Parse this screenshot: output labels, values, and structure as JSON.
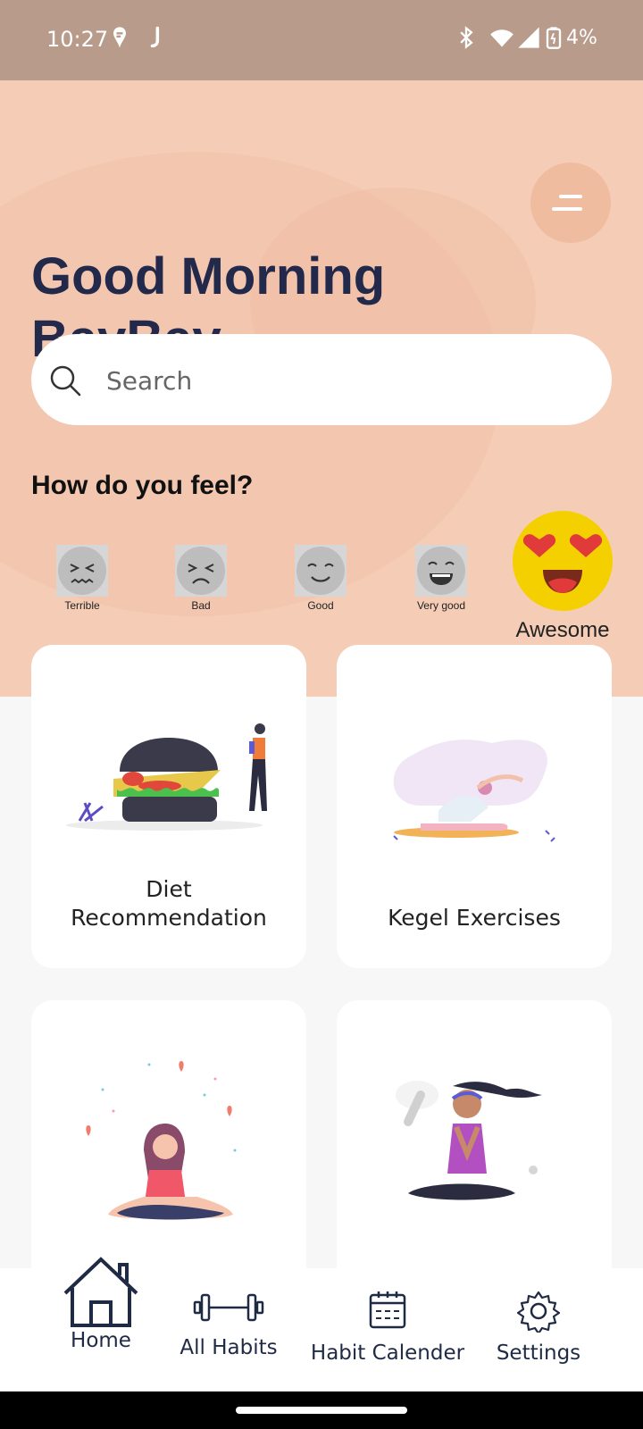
{
  "status_bar": {
    "time": "10:27",
    "battery": "4%"
  },
  "header": {
    "greeting": "Good Morning",
    "username": "BavBav",
    "menu_icon": "menu-icon"
  },
  "search": {
    "placeholder": "Search"
  },
  "mood": {
    "title": "How do you feel?",
    "options": [
      {
        "label": "Terrible"
      },
      {
        "label": "Bad"
      },
      {
        "label": "Good"
      },
      {
        "label": "Very good"
      },
      {
        "label": "Awesome"
      }
    ],
    "selected": "Awesome"
  },
  "cards": [
    {
      "line1": "Diet",
      "line2": "Recommendation"
    },
    {
      "line1": "",
      "line2": "Kegel Exercises"
    },
    {
      "line1": "",
      "line2": ""
    },
    {
      "line1": "",
      "line2": ""
    }
  ],
  "bottom_nav": {
    "items": [
      {
        "label": "Home",
        "icon": "home-icon"
      },
      {
        "label": "All Habits",
        "icon": "dumbbell-icon"
      },
      {
        "label": "Habit Calender",
        "icon": "calendar-icon"
      },
      {
        "label": "Settings",
        "icon": "gear-icon"
      }
    ],
    "active": "Home"
  },
  "colors": {
    "hero_bg": "#f5ccb6",
    "status_bg": "#b99b8c",
    "text_dark": "#22294a",
    "emoji_yellow": "#f5d000",
    "heart_red": "#e03a3a"
  }
}
